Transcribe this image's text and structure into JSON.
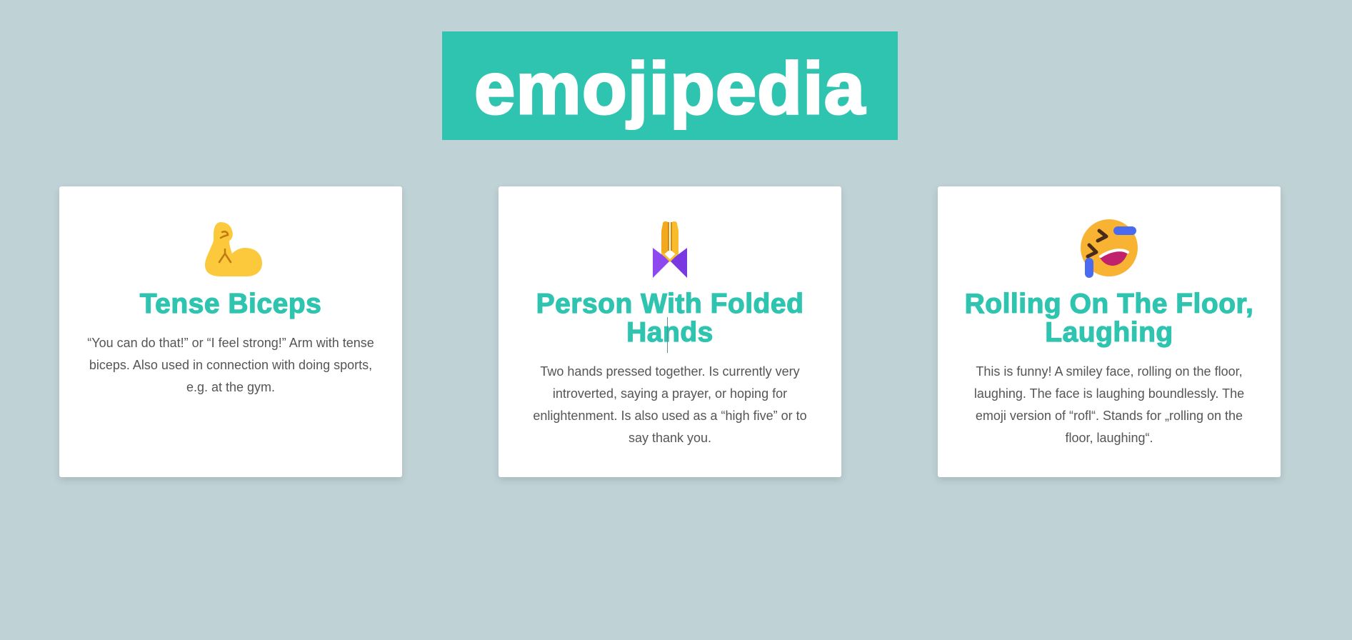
{
  "header": {
    "logo_text": "emojipedia"
  },
  "colors": {
    "background": "#bfd2d5",
    "accent": "#2ec4b0",
    "card": "#ffffff",
    "text": "#555555"
  },
  "cards": [
    {
      "emoji_icon": "flexed-biceps-icon",
      "title": "Tense Biceps",
      "description": "“You can do that!” or “I feel strong!” Arm with tense biceps. Also used in connection with doing sports, e.g. at the gym."
    },
    {
      "emoji_icon": "folded-hands-icon",
      "title": "Person With Folded Hands",
      "description": "Two hands pressed together. Is currently very introverted, saying a prayer, or hoping for enlightenment. Is also used as a “high five” or to say thank you."
    },
    {
      "emoji_icon": "rolling-on-the-floor-laughing-icon",
      "title": "Rolling On The Floor, Laughing",
      "description": "This is funny! A smiley face, rolling on the floor, laughing. The face is laughing boundlessly. The emoji version of “rofl“. Stands for „rolling on the floor, laughing“."
    }
  ]
}
